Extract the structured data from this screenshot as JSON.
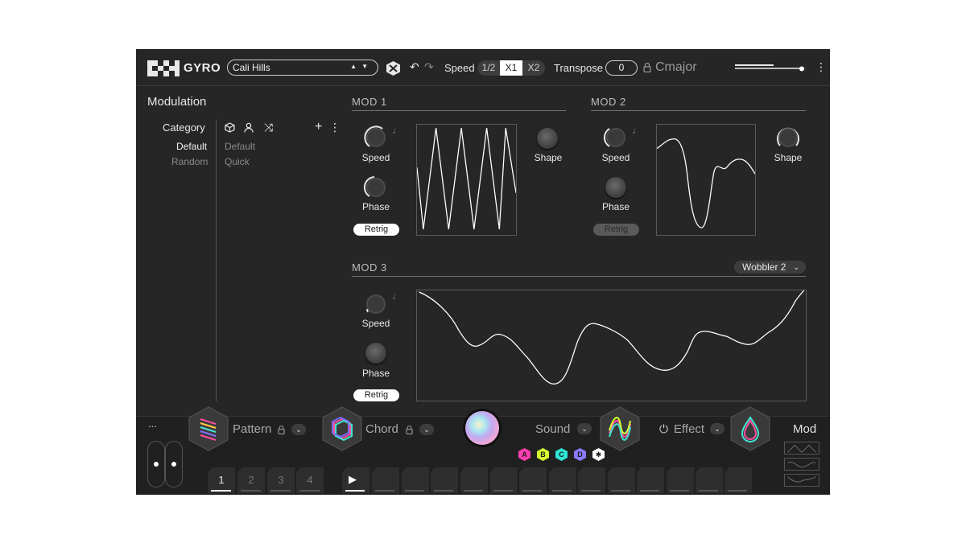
{
  "header": {
    "app_name": "GYRO",
    "preset": "Cali Hills",
    "speed_label": "Speed",
    "speed_options": [
      "1/2",
      "X1",
      "X2"
    ],
    "speed_selected": "X1",
    "transpose_label": "Transpose",
    "transpose_value": "0",
    "host_name": "Cmajor"
  },
  "modulation": {
    "title": "Modulation",
    "category_label": "Category",
    "categories": [
      "Default",
      "Random"
    ],
    "presets": [
      "Default",
      "Quick"
    ]
  },
  "mods": [
    {
      "title": "MOD 1",
      "speed_label": "Speed",
      "phase_label": "Phase",
      "shape_label": "Shape",
      "retrig_label": "Retrig",
      "retrig_on": true
    },
    {
      "title": "MOD 2",
      "speed_label": "Speed",
      "phase_label": "Phase",
      "shape_label": "Shape",
      "retrig_label": "Retrig",
      "retrig_on": false
    },
    {
      "title": "MOD 3",
      "speed_label": "Speed",
      "phase_label": "Phase",
      "retrig_label": "Retrig",
      "retrig_on": true,
      "waveform": "Wobbler 2"
    }
  ],
  "bottom": {
    "more": "...",
    "pattern_label": "Pattern",
    "chord_label": "Chord",
    "sound_label": "Sound",
    "effect_label": "Effect",
    "mod_label": "Mod",
    "pattern_pages": [
      "1",
      "2",
      "3",
      "4"
    ],
    "active_page": "1",
    "sound_slots": [
      "A",
      "B",
      "C",
      "D"
    ]
  },
  "colors": {
    "panel": "#262626",
    "badge_a": "#ff3fb0",
    "badge_b": "#d6ff2e",
    "badge_c": "#2ee6d6",
    "badge_d": "#8a7bff"
  }
}
